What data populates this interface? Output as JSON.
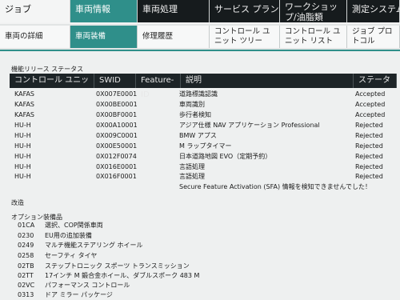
{
  "top_tabs": [
    {
      "label": "ジョブ"
    },
    {
      "label": "車両情報"
    },
    {
      "label": "車両処理"
    },
    {
      "label": "サービス プラン"
    },
    {
      "label": "ワークショップ/油脂類"
    },
    {
      "label": "測定システム"
    }
  ],
  "sub_tabs": [
    {
      "label": "車両の詳細"
    },
    {
      "label": "車両装備"
    },
    {
      "label": "修理履歴"
    },
    {
      "label": "コントロール ユニット ツリー"
    },
    {
      "label": "コントロール ユニット リスト"
    },
    {
      "label": "ジョブ プロトコル"
    }
  ],
  "release_section": {
    "title": "機能リリース ステータス",
    "columns": [
      "コントロール ユニット",
      "SWID",
      "Feature-ID",
      "説明",
      "ステータス"
    ],
    "rows": [
      {
        "unit": "KAFAS",
        "swid": "0X007E0001",
        "desc": "道路標識認識",
        "status": "Accepted"
      },
      {
        "unit": "KAFAS",
        "swid": "0X00BE0001",
        "desc": "車両識別",
        "status": "Accepted"
      },
      {
        "unit": "KAFAS",
        "swid": "0X00BF0001",
        "desc": "歩行者検知",
        "status": "Accepted"
      },
      {
        "unit": "HU-H",
        "swid": "0X00A10001",
        "desc": "アジア仕様 NAV アプリケーション Professional",
        "status": "Rejected"
      },
      {
        "unit": "HU-H",
        "swid": "0X009C0001",
        "desc": "BMW アプス",
        "status": "Rejected"
      },
      {
        "unit": "HU-H",
        "swid": "0X00E50001",
        "desc": "M ラップタイマー",
        "status": "Rejected"
      },
      {
        "unit": "HU-H",
        "swid": "0X012F0074",
        "desc": "日本道路地図 EVO（定期予約）",
        "status": "Rejected"
      },
      {
        "unit": "HU-H",
        "swid": "0X016E0001",
        "desc": "言語処理",
        "status": "Rejected"
      },
      {
        "unit": "HU-H",
        "swid": "0X016F0001",
        "desc": "言語処理",
        "status": "Rejected"
      }
    ],
    "message": "Secure Feature Activation (SFA) 情報を検知できませんでした！"
  },
  "retrofit_label": "改造",
  "options_section": {
    "title": "オプション装備品",
    "items": [
      {
        "code": "01CA",
        "desc": "選択、COP関係車両"
      },
      {
        "code": "0230",
        "desc": "EU用の追加装備"
      },
      {
        "code": "0249",
        "desc": "マルチ機能ステアリング ホイール"
      },
      {
        "code": "0258",
        "desc": "セーフティ タイヤ"
      },
      {
        "code": "02TB",
        "desc": "ステップトロニック スポーツ トランスミッション"
      },
      {
        "code": "02TT",
        "desc": "17インチ M 鍛合金ホイール、ダブルスポーク 483 M"
      },
      {
        "code": "02VC",
        "desc": "パフォーマンス コントロール"
      },
      {
        "code": "0313",
        "desc": "ドア ミラー パッケージ"
      }
    ]
  }
}
